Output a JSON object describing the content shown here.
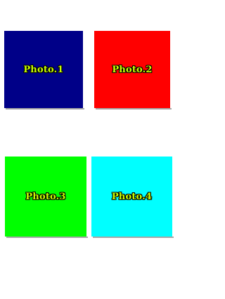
{
  "photos": [
    {
      "label": "Photo.1",
      "color": "#000088"
    },
    {
      "label": "Photo.2",
      "color": "#ff0000"
    },
    {
      "label": "Photo.3",
      "color": "#00ff00"
    },
    {
      "label": "Photo.4",
      "color": "#00ffff"
    }
  ],
  "label_color": "#c8ff00"
}
